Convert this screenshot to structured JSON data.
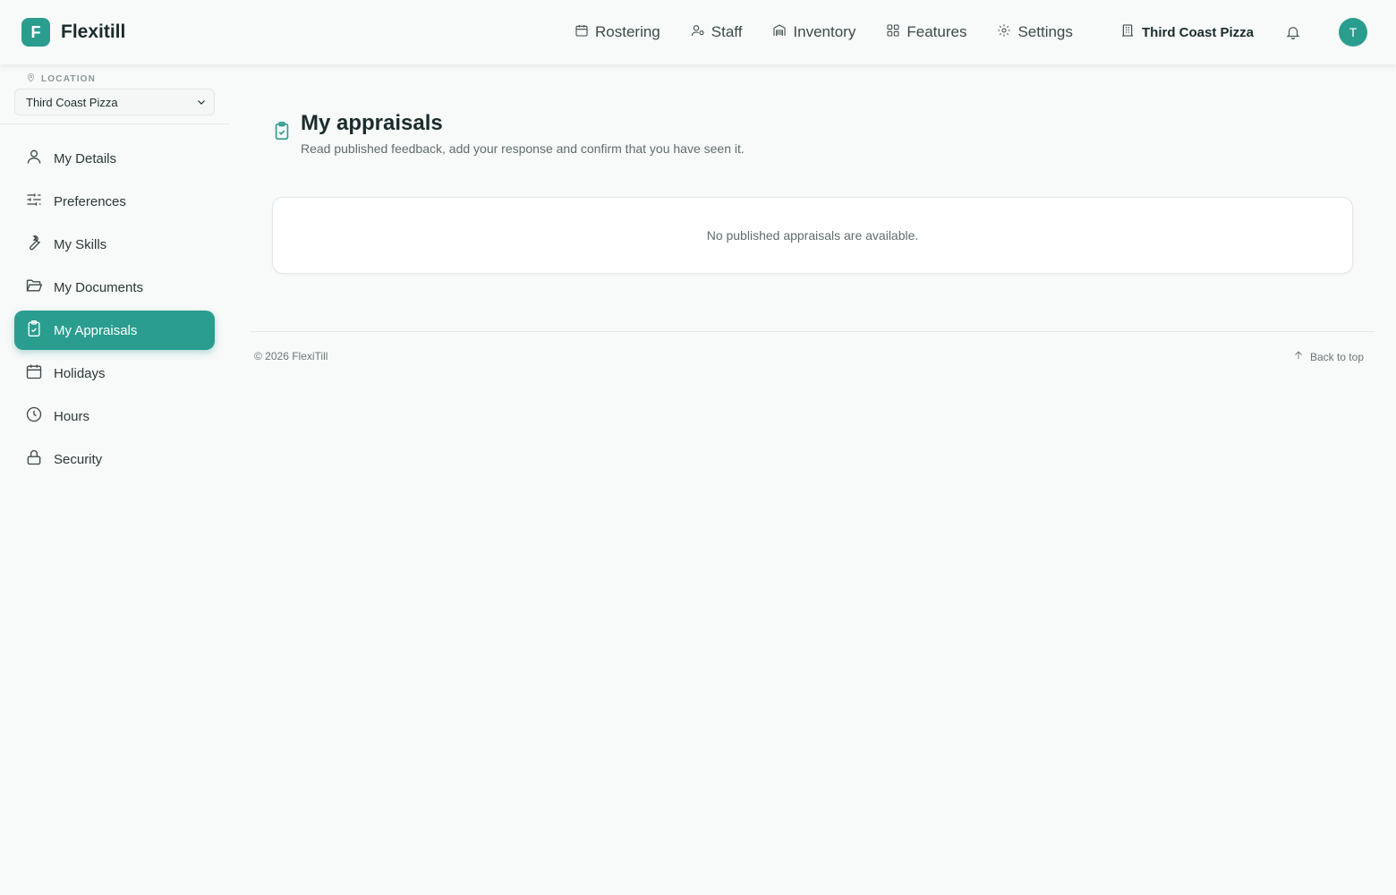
{
  "app": {
    "logo_letter": "F",
    "name": "Flexitill"
  },
  "topnav": {
    "items": [
      {
        "label": "Rostering",
        "icon": "calendar-icon"
      },
      {
        "label": "Staff",
        "icon": "user-cog-icon"
      },
      {
        "label": "Inventory",
        "icon": "warehouse-icon"
      },
      {
        "label": "Features",
        "icon": "grid-icon"
      },
      {
        "label": "Settings",
        "icon": "gear-icon"
      }
    ],
    "location": "Third Coast Pizza",
    "avatar_initial": "T"
  },
  "sidebar": {
    "location_label": "LOCATION",
    "location_value": "Third Coast Pizza",
    "items": [
      {
        "label": "My Details",
        "icon": "user-icon"
      },
      {
        "label": "Preferences",
        "icon": "sliders-icon"
      },
      {
        "label": "My Skills",
        "icon": "wrench-icon"
      },
      {
        "label": "My Documents",
        "icon": "folder-open-icon"
      },
      {
        "label": "My Appraisals",
        "icon": "clipboard-check-icon",
        "active": true
      },
      {
        "label": "Holidays",
        "icon": "calendar-days-icon"
      },
      {
        "label": "Hours",
        "icon": "clock-icon"
      },
      {
        "label": "Security",
        "icon": "lock-icon"
      }
    ]
  },
  "main": {
    "title": "My appraisals",
    "subtitle": "Read published feedback, add your response and confirm that you have seen it.",
    "empty_message": "No published appraisals are available."
  },
  "footer": {
    "copyright": "© 2026 FlexiTill",
    "back_to_top": "Back to top"
  },
  "colors": {
    "accent": "#2a9d8f",
    "background": "#f8f9f9"
  }
}
